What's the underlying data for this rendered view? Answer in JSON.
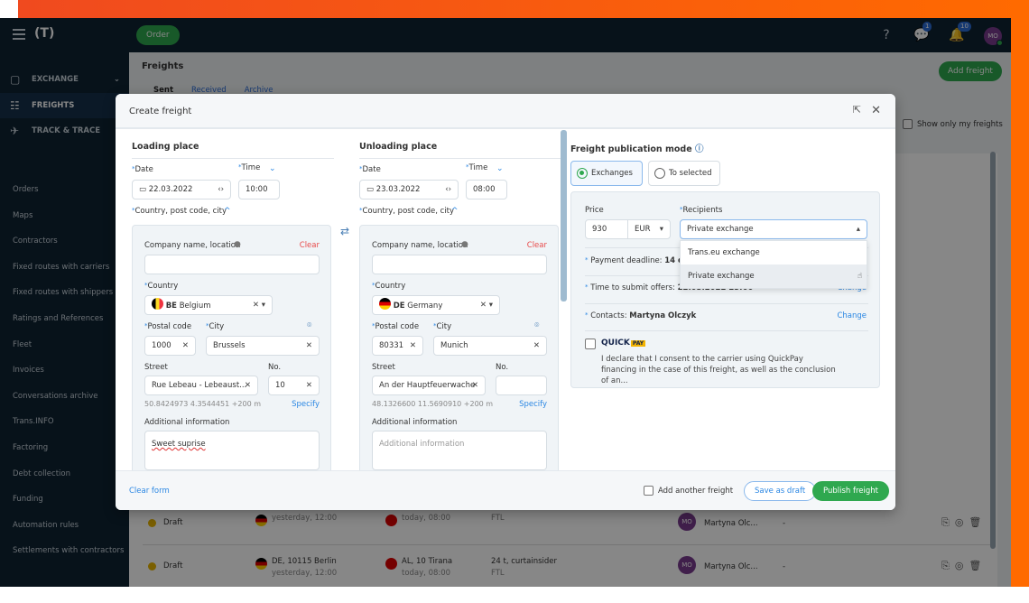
{
  "header": {
    "logo": "(T)",
    "order_label": "Order",
    "messages_badge": "1",
    "notifications_badge": "10",
    "avatar": "MO"
  },
  "sidebar": {
    "sections": [
      {
        "label": "EXCHANGE",
        "icon": "box-icon"
      },
      {
        "label": "FREIGHTS",
        "icon": "freight-icon"
      },
      {
        "label": "TRACK & TRACE",
        "icon": "satellite-icon"
      }
    ],
    "items": [
      "Orders",
      "Maps",
      "Contractors",
      "Fixed routes with carriers",
      "Fixed routes with shippers",
      "Ratings and References",
      "Fleet",
      "Invoices",
      "Conversations archive",
      "Trans.INFO",
      "Factoring",
      "Debt collection",
      "Funding",
      "Automation rules",
      "Settlements with contractors"
    ]
  },
  "page": {
    "title": "Freights",
    "tabs": [
      "Sent",
      "Received",
      "Archive"
    ],
    "add_freight": "Add freight",
    "show_only_mine": "Show only my freights"
  },
  "rows": [
    {
      "status": "Draft",
      "from": "",
      "from_time": "yesterday, 12:00",
      "to": "",
      "to_time": "today, 08:00",
      "load": "",
      "load_type": "FTL",
      "user": "Martyna Olc...",
      "avatar": "MO",
      "extra": "-"
    },
    {
      "status": "Draft",
      "from": "DE, 10115 Berlin",
      "from_time": "yesterday, 12:00",
      "to": "AL, 10 Tirana",
      "to_time": "today, 08:00",
      "load": "24 t, curtainsider",
      "load_type": "FTL",
      "user": "Martyna Olc...",
      "avatar": "MO",
      "extra": "-"
    }
  ],
  "modal": {
    "title": "Create freight",
    "loading": {
      "title": "Loading place",
      "date_label": "Date",
      "date": "22.03.2022",
      "time_label": "Time",
      "time": "10:00",
      "location_label": "Country, post code, city",
      "company_label": "Company name, location",
      "clear": "Clear",
      "country_label": "Country",
      "country_code": "BE",
      "country": "Belgium",
      "postal_label": "Postal code",
      "postal": "1000",
      "city_label": "City",
      "city": "Brussels",
      "street_label": "Street",
      "street": "Rue Lebeau - Lebeaust...",
      "no_label": "No.",
      "no": "10",
      "coords": "50.8424973 4.3544451 +200 m",
      "specify": "Specify",
      "info_label": "Additional information",
      "info": "Sweet suprise"
    },
    "unloading": {
      "title": "Unloading place",
      "date_label": "Date",
      "date": "23.03.2022",
      "time_label": "Time",
      "time": "08:00",
      "location_label": "Country, post code, city",
      "company_label": "Company name, location",
      "clear": "Clear",
      "country_label": "Country",
      "country_code": "DE",
      "country": "Germany",
      "postal_label": "Postal code",
      "postal": "80331",
      "city_label": "City",
      "city": "Munich",
      "street_label": "Street",
      "street": "An der Hauptfeuerwache",
      "no_label": "No.",
      "no": "",
      "coords": "48.1326600 11.5690910 +200 m",
      "specify": "Specify",
      "info_label": "Additional information",
      "info_placeholder": "Additional information"
    },
    "publication": {
      "title": "Freight publication mode",
      "modes": [
        "Exchanges",
        "To selected"
      ],
      "selected_mode": "Exchanges",
      "price_label": "Price",
      "price": "930",
      "currency": "EUR",
      "recipients_label": "Recipients",
      "recipients": "Private exchange",
      "options": [
        "Trans.eu exchange",
        "Private exchange"
      ],
      "payment_label": "Payment deadline:",
      "payment": "14 da",
      "offers_label": "Time to submit offers:",
      "offers": "22.03.2022 23:00",
      "contacts_label": "Contacts:",
      "contacts": "Martyna Olczyk",
      "change": "Change",
      "quick": "QUICK",
      "pay": "PAY",
      "consent": "I declare that I consent to the carrier using QuickPay financing in the case of this freight, as well as the conclusion of an..."
    },
    "footer": {
      "clear_form": "Clear form",
      "add_another": "Add another freight",
      "save_draft": "Save as draft",
      "publish": "Publish freight"
    }
  },
  "colors": {
    "accent": "#2b87e3",
    "green": "#2fa84f",
    "navy": "#0f2232",
    "brand_orange": "#ff6a00"
  }
}
